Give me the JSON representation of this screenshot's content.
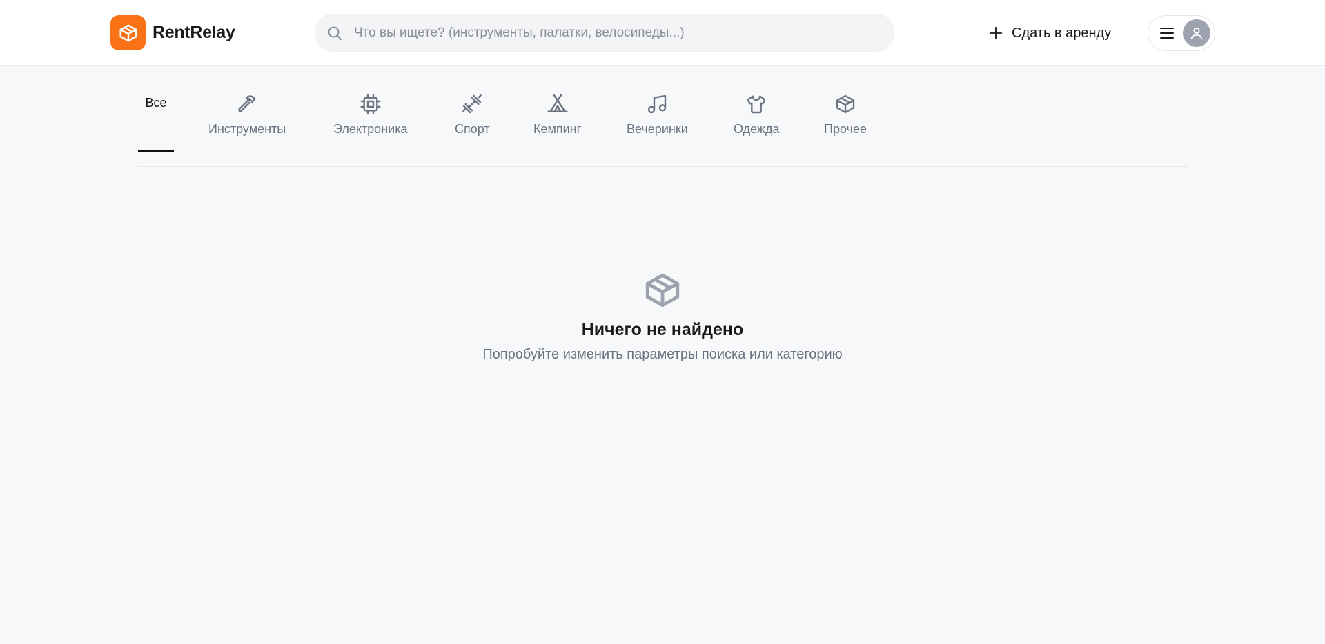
{
  "app": {
    "name": "RentRelay",
    "brand_color": "#f97316"
  },
  "header": {
    "search_placeholder": "Что вы ищете? (инструменты, палатки, велосипеды...)",
    "list_item_label": "Сдать в аренду"
  },
  "categories": [
    {
      "label": "Все",
      "icon": "none",
      "active": true
    },
    {
      "label": "Инструменты",
      "icon": "hammer-icon"
    },
    {
      "label": "Электроника",
      "icon": "chip-icon"
    },
    {
      "label": "Спорт",
      "icon": "dumbbell-icon"
    },
    {
      "label": "Кемпинг",
      "icon": "tent-icon"
    },
    {
      "label": "Вечеринки",
      "icon": "music-note-icon"
    },
    {
      "label": "Одежда",
      "icon": "shirt-icon"
    },
    {
      "label": "Прочее",
      "icon": "box-icon"
    }
  ],
  "empty_state": {
    "icon": "box-icon",
    "title": "Ничего не найдено",
    "subtitle": "Попробуйте изменить параметры поиска или категорию"
  }
}
